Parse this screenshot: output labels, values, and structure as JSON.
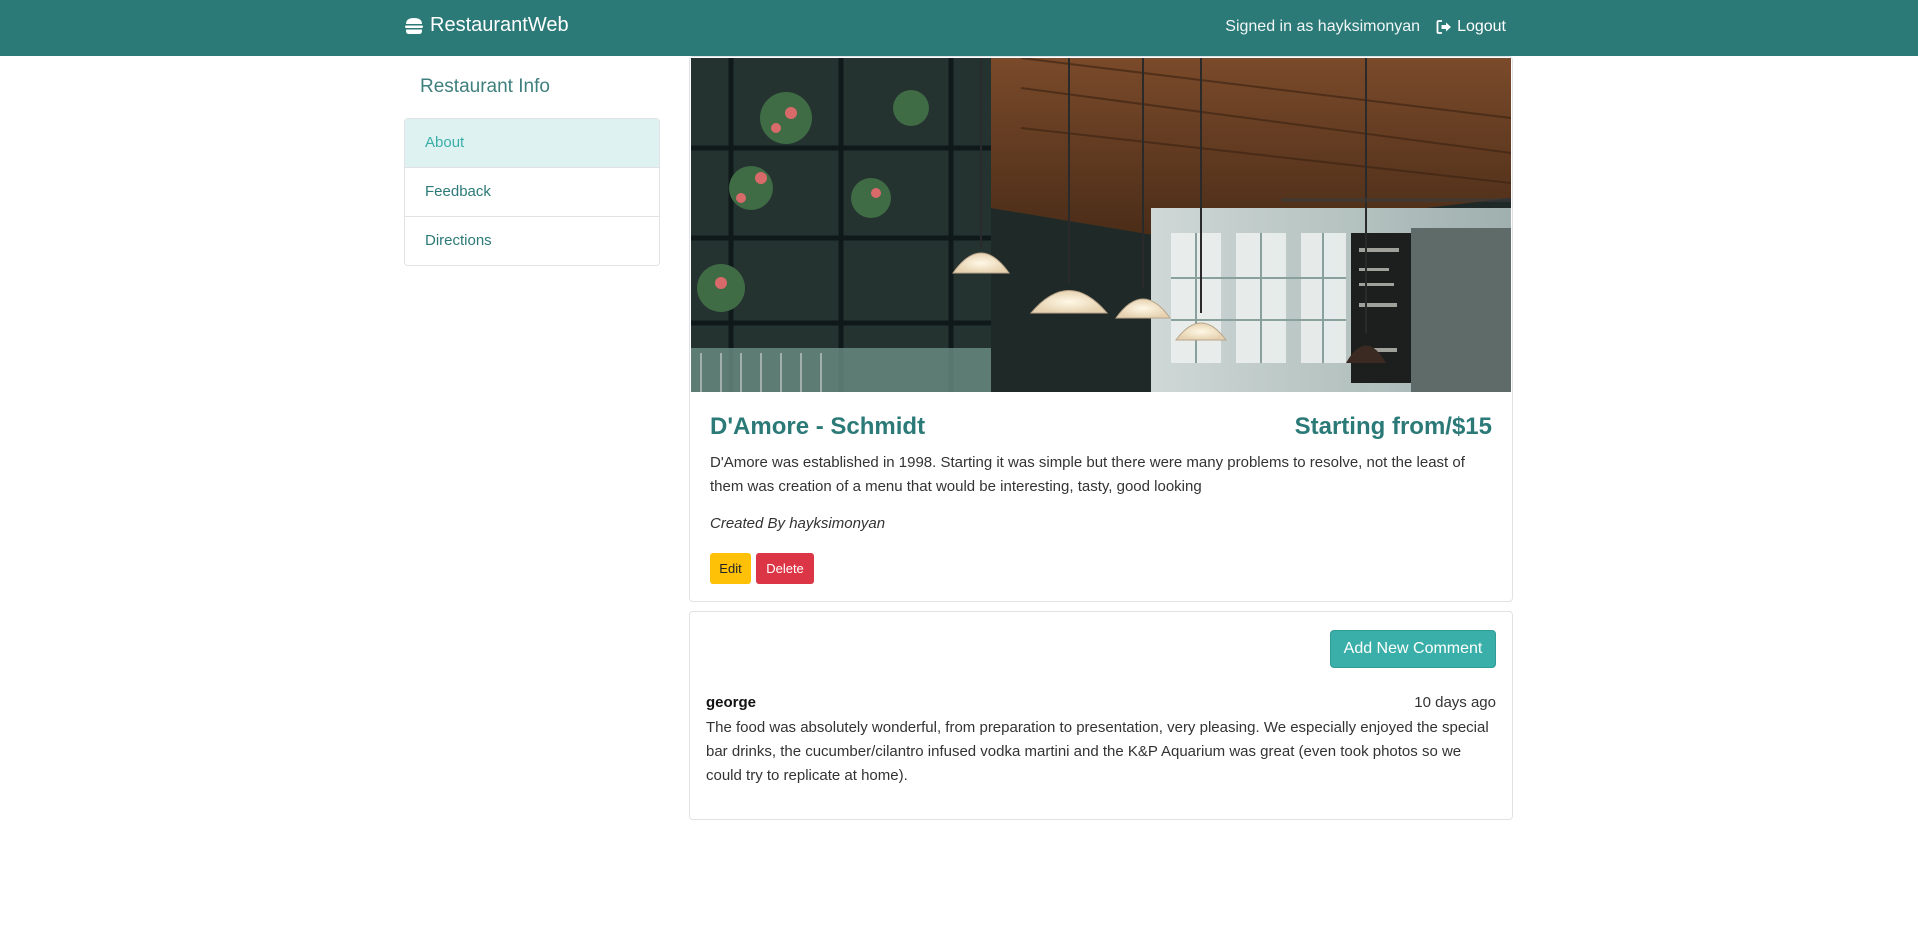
{
  "navbar": {
    "brand": "RestaurantWeb",
    "brand_icon": "hamburger-icon",
    "signed_in_text": "Signed in as hayksimonyan",
    "logout_label": "Logout",
    "logout_icon": "sign-out-icon",
    "background": "#2b7a78"
  },
  "sidebar": {
    "title": "Restaurant Info",
    "items": [
      {
        "label": "About",
        "active": true
      },
      {
        "label": "Feedback",
        "active": false
      },
      {
        "label": "Directions",
        "active": false
      }
    ]
  },
  "restaurant": {
    "name": "D'Amore - Schmidt",
    "price": "Starting from/$15",
    "description": "D'Amore was established in 1998. Starting it was simple but there were many problems to resolve, not the least of them was creation of a menu that would be interesting, tasty, good looking",
    "created_by_prefix": "Created By",
    "created_by_user": "hayksimonyan",
    "edit_label": "Edit",
    "delete_label": "Delete"
  },
  "comments": {
    "add_label": "Add New Comment",
    "items": [
      {
        "author": "george",
        "time": "10 days ago",
        "text": "The food was absolutely wonderful, from preparation to presentation, very pleasing. We especially enjoyed the special bar drinks, the cucumber/cilantro infused vodka martini and the K&P Aquarium was great (even took photos so we could try to replicate at home)."
      }
    ]
  },
  "colors": {
    "primary": "#2b7a78",
    "accent": "#3aafa9",
    "active_bg": "#def2f1",
    "edit": "#ffc107",
    "delete": "#dc3545"
  }
}
